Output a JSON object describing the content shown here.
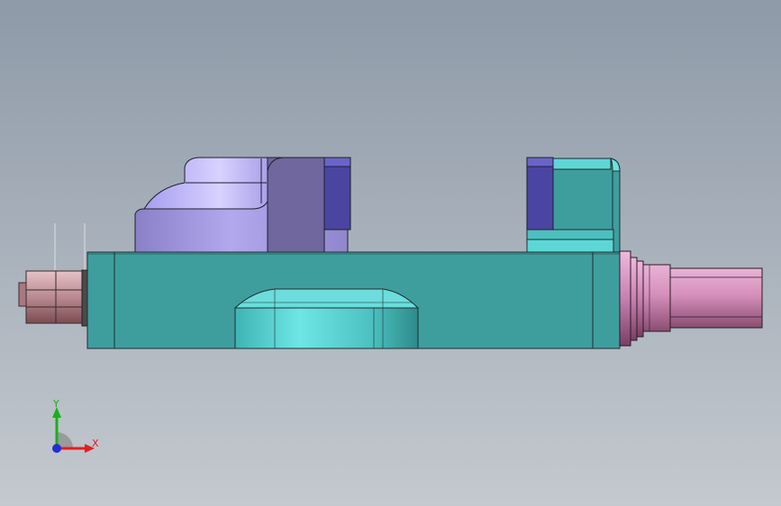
{
  "viewport": {
    "background_top": "#8e9aa8",
    "background_bottom": "#c4c9cf"
  },
  "model": {
    "base_color": "#3e9e9e",
    "base_highlight": "#5fd2d2",
    "jaw_color": "#9c8fd6",
    "jaw_shadow": "#6f679e",
    "jaw_pad_color": "#4a45a0",
    "screw_color": "#c87ca8",
    "nut_color": "#c99aa0"
  },
  "triad": {
    "x_label": "X",
    "y_label": "Y",
    "x_color": "#e02020",
    "y_color": "#18b018",
    "z_color": "#2030d0"
  }
}
